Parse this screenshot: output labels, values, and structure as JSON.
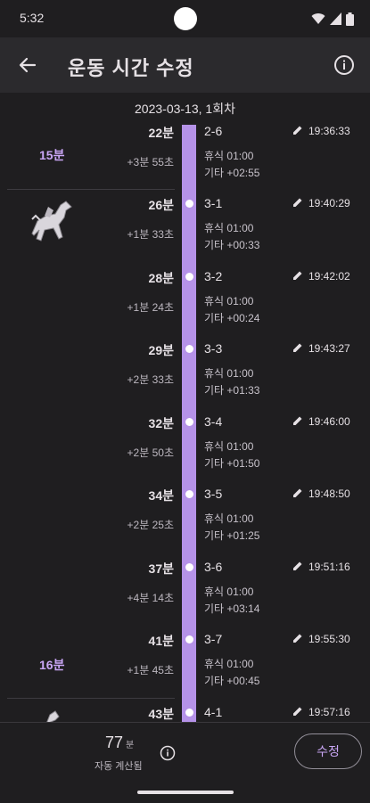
{
  "status_bar": {
    "time": "5:32"
  },
  "app_bar": {
    "title": "운동 시간 수정"
  },
  "date_header": "2023-03-13, 1회차",
  "sessions": [
    {
      "label": "15분"
    },
    {
      "label": "16분"
    }
  ],
  "rows": [
    {
      "minute": "22분",
      "delta": "+3분 55초",
      "set": "2-6",
      "rest": "휴식 01:00",
      "other": "기타 +02:55",
      "time": "19:36:33"
    },
    {
      "minute": "26분",
      "delta": "+1분 33초",
      "set": "3-1",
      "rest": "휴식 01:00",
      "other": "기타 +00:33",
      "time": "19:40:29"
    },
    {
      "minute": "28분",
      "delta": "+1분 24초",
      "set": "3-2",
      "rest": "휴식 01:00",
      "other": "기타 +00:24",
      "time": "19:42:02"
    },
    {
      "minute": "29분",
      "delta": "+2분 33초",
      "set": "3-3",
      "rest": "휴식 01:00",
      "other": "기타 +01:33",
      "time": "19:43:27"
    },
    {
      "minute": "32분",
      "delta": "+2분 50초",
      "set": "3-4",
      "rest": "휴식 01:00",
      "other": "기타 +01:50",
      "time": "19:46:00"
    },
    {
      "minute": "34분",
      "delta": "+2분 25초",
      "set": "3-5",
      "rest": "휴식 01:00",
      "other": "기타 +01:25",
      "time": "19:48:50"
    },
    {
      "minute": "37분",
      "delta": "+4분 14초",
      "set": "3-6",
      "rest": "휴식 01:00",
      "other": "기타 +03:14",
      "time": "19:51:16"
    },
    {
      "minute": "41분",
      "delta": "+1분 45초",
      "set": "3-7",
      "rest": "휴식 01:00",
      "other": "기타 +00:45",
      "time": "19:55:30"
    },
    {
      "minute": "43분",
      "delta": "",
      "set": "4-1",
      "rest": "",
      "other": "",
      "time": "19:57:16"
    }
  ],
  "footer": {
    "total_value": "77",
    "total_unit": "분",
    "total_label": "자동 계산됨",
    "edit_label": "수정"
  },
  "colors": {
    "accent": "#c9a6f5",
    "timeline": "#b592e8",
    "background": "#1f1e20"
  }
}
